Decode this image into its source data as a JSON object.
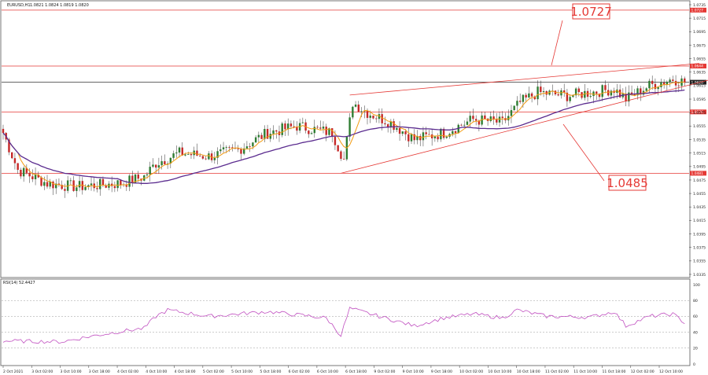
{
  "header": {
    "symbol_label": "EURUSD,H1",
    "ohlc_text": "1.0821 1.0824 1.0819 1.0820"
  },
  "rsi_header": "RSI(14) 52.4427",
  "colors": {
    "candle_bull": "#2e7d32",
    "candle_bear": "#c62828",
    "ma_fast": "#f39c12",
    "ma_slow": "#5b2c8f",
    "level_line": "#e53935",
    "price_line": "#333333",
    "rsi_line": "#c04fc0"
  },
  "chart_data": {
    "type": "candlestick",
    "y_axis": {
      "min": 1.0335,
      "max": 1.0735,
      "ticks": [
        "1.0735",
        "1.0715",
        "1.0695",
        "1.0675",
        "1.0655",
        "1.0635",
        "1.0615",
        "1.0595",
        "1.0575",
        "1.0555",
        "1.0535",
        "1.0515",
        "1.0495",
        "1.0475",
        "1.0455",
        "1.0435",
        "1.0415",
        "1.0395",
        "1.0375",
        "1.0355",
        "1.0335"
      ]
    },
    "x_axis": {
      "ticks": [
        "2 Oct 2021",
        "3 Oct 02:00",
        "3 Oct 10:00",
        "3 Oct 18:00",
        "4 Oct 02:00",
        "4 Oct 10:00",
        "4 Oct 18:00",
        "5 Oct 02:00",
        "5 Oct 10:00",
        "5 Oct 18:00",
        "6 Oct 02:00",
        "6 Oct 10:00",
        "6 Oct 18:00",
        "9 Oct 02:00",
        "9 Oct 10:00",
        "9 Oct 18:00",
        "10 Oct 02:00",
        "10 Oct 10:00",
        "10 Oct 18:00",
        "11 Oct 02:00",
        "11 Oct 10:00",
        "11 Oct 18:00",
        "12 Oct 02:00",
        "12 Oct 10:00"
      ]
    },
    "levels": {
      "upper_target": "1.0727",
      "resistance": "1.0644",
      "current": "1.0620",
      "support": "1.0576",
      "lower_target": "1.0485",
      "lower_target_tag": "1.0481"
    },
    "annotations": [
      "1.0727",
      "1.0485"
    ],
    "price_keypoints": [
      {
        "i": 0,
        "p": 1.0545
      },
      {
        "i": 5,
        "p": 1.049
      },
      {
        "i": 15,
        "p": 1.047
      },
      {
        "i": 25,
        "p": 1.0465
      },
      {
        "i": 40,
        "p": 1.047
      },
      {
        "i": 48,
        "p": 1.048
      },
      {
        "i": 52,
        "p": 1.05
      },
      {
        "i": 60,
        "p": 1.0515
      },
      {
        "i": 70,
        "p": 1.051
      },
      {
        "i": 80,
        "p": 1.052
      },
      {
        "i": 90,
        "p": 1.0545
      },
      {
        "i": 100,
        "p": 1.0555
      },
      {
        "i": 112,
        "p": 1.0545
      },
      {
        "i": 116,
        "p": 1.0505
      },
      {
        "i": 119,
        "p": 1.059
      },
      {
        "i": 124,
        "p": 1.0575
      },
      {
        "i": 132,
        "p": 1.056
      },
      {
        "i": 140,
        "p": 1.0535
      },
      {
        "i": 150,
        "p": 1.0545
      },
      {
        "i": 160,
        "p": 1.0565
      },
      {
        "i": 170,
        "p": 1.056
      },
      {
        "i": 176,
        "p": 1.059
      },
      {
        "i": 182,
        "p": 1.0605
      },
      {
        "i": 192,
        "p": 1.06
      },
      {
        "i": 200,
        "p": 1.0605
      },
      {
        "i": 208,
        "p": 1.061
      },
      {
        "i": 212,
        "p": 1.0595
      },
      {
        "i": 220,
        "p": 1.0615
      },
      {
        "i": 228,
        "p": 1.0625
      },
      {
        "i": 232,
        "p": 1.062
      }
    ],
    "rsi": {
      "ticks": [
        "100",
        "80",
        "60",
        "40",
        "20",
        "0"
      ],
      "range": [
        0,
        100
      ],
      "keypoints": [
        {
          "i": 0,
          "v": 29
        },
        {
          "i": 20,
          "v": 28
        },
        {
          "i": 30,
          "v": 35
        },
        {
          "i": 40,
          "v": 41
        },
        {
          "i": 48,
          "v": 45
        },
        {
          "i": 52,
          "v": 60
        },
        {
          "i": 56,
          "v": 68
        },
        {
          "i": 70,
          "v": 60
        },
        {
          "i": 90,
          "v": 66
        },
        {
          "i": 110,
          "v": 58
        },
        {
          "i": 115,
          "v": 36
        },
        {
          "i": 118,
          "v": 70
        },
        {
          "i": 125,
          "v": 63
        },
        {
          "i": 140,
          "v": 48
        },
        {
          "i": 150,
          "v": 58
        },
        {
          "i": 160,
          "v": 63
        },
        {
          "i": 170,
          "v": 58
        },
        {
          "i": 175,
          "v": 68
        },
        {
          "i": 185,
          "v": 60
        },
        {
          "i": 200,
          "v": 59
        },
        {
          "i": 208,
          "v": 66
        },
        {
          "i": 212,
          "v": 48
        },
        {
          "i": 220,
          "v": 60
        },
        {
          "i": 228,
          "v": 63
        },
        {
          "i": 232,
          "v": 52
        }
      ]
    }
  }
}
